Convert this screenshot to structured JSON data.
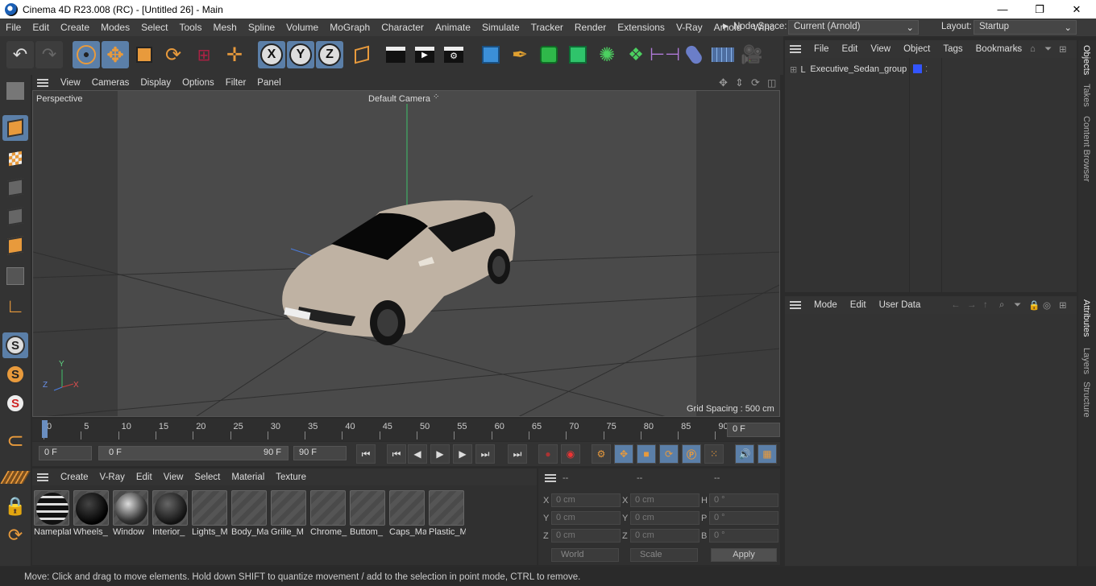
{
  "window": {
    "title": "Cinema 4D R23.008 (RC) - [Untitled 26] - Main",
    "minimize": "—",
    "maximize": "❐",
    "close": "✕"
  },
  "menu": {
    "items": [
      "File",
      "Edit",
      "Create",
      "Modes",
      "Select",
      "Tools",
      "Mesh",
      "Spline",
      "Volume",
      "MoGraph",
      "Character",
      "Animate",
      "Simulate",
      "Tracker",
      "Render",
      "Extensions",
      "V-Ray",
      "Arnold",
      "Winc"
    ],
    "node_space_label": "Node Space:",
    "node_space_value": "Current (Arnold)",
    "layout_label": "Layout:",
    "layout_value": "Startup"
  },
  "viewport": {
    "menu": [
      "View",
      "Cameras",
      "Display",
      "Options",
      "Filter",
      "Panel"
    ],
    "view_name": "Perspective",
    "camera": "Default Camera",
    "grid_spacing": "Grid Spacing : 500 cm",
    "axis_z": "Z",
    "axis_y": "Y",
    "axis_x": "X"
  },
  "timeline": {
    "ticks": [
      "0",
      "5",
      "10",
      "15",
      "20",
      "25",
      "30",
      "35",
      "40",
      "45",
      "50",
      "55",
      "60",
      "65",
      "70",
      "75",
      "80",
      "85",
      "90"
    ],
    "current_frame": "0 F"
  },
  "transport": {
    "start": "0 F",
    "range_start": "0 F",
    "range_end": "90 F",
    "end": "90 F"
  },
  "materials": {
    "menu": [
      "Create",
      "V-Ray",
      "Edit",
      "View",
      "Select",
      "Material",
      "Texture"
    ],
    "items": [
      "Nameplat",
      "Wheels_",
      "Window",
      "Interior_",
      "Lights_M",
      "Body_Ma",
      "Grille_M",
      "Chrome_",
      "Buttom_",
      "Caps_Ma",
      "Plastic_M"
    ]
  },
  "coords": {
    "header": [
      "--",
      "--",
      "--"
    ],
    "rows": [
      {
        "a": "X",
        "av": "0 cm",
        "b": "X",
        "bv": "0 cm",
        "c": "H",
        "cv": "0 °"
      },
      {
        "a": "Y",
        "av": "0 cm",
        "b": "Y",
        "bv": "0 cm",
        "c": "P",
        "cv": "0 °"
      },
      {
        "a": "Z",
        "av": "0 cm",
        "b": "Z",
        "bv": "0 cm",
        "c": "B",
        "cv": "0 °"
      }
    ],
    "space": "World",
    "mode": "Scale",
    "apply": "Apply"
  },
  "objects": {
    "menu": [
      "File",
      "Edit",
      "View",
      "Object",
      "Tags",
      "Bookmarks"
    ],
    "items": [
      {
        "name": "Executive_Sedan_group",
        "color": "#3355ff"
      }
    ]
  },
  "attributes": {
    "menu": [
      "Mode",
      "Edit",
      "User Data"
    ]
  },
  "sidetabs": {
    "top": [
      "Objects",
      "Takes",
      "Content Browser"
    ],
    "bottom": [
      "Attributes",
      "Layers",
      "Structure"
    ]
  },
  "status": "Move: Click and drag to move elements. Hold down SHIFT to quantize movement / add to the selection in point mode, CTRL to remove."
}
